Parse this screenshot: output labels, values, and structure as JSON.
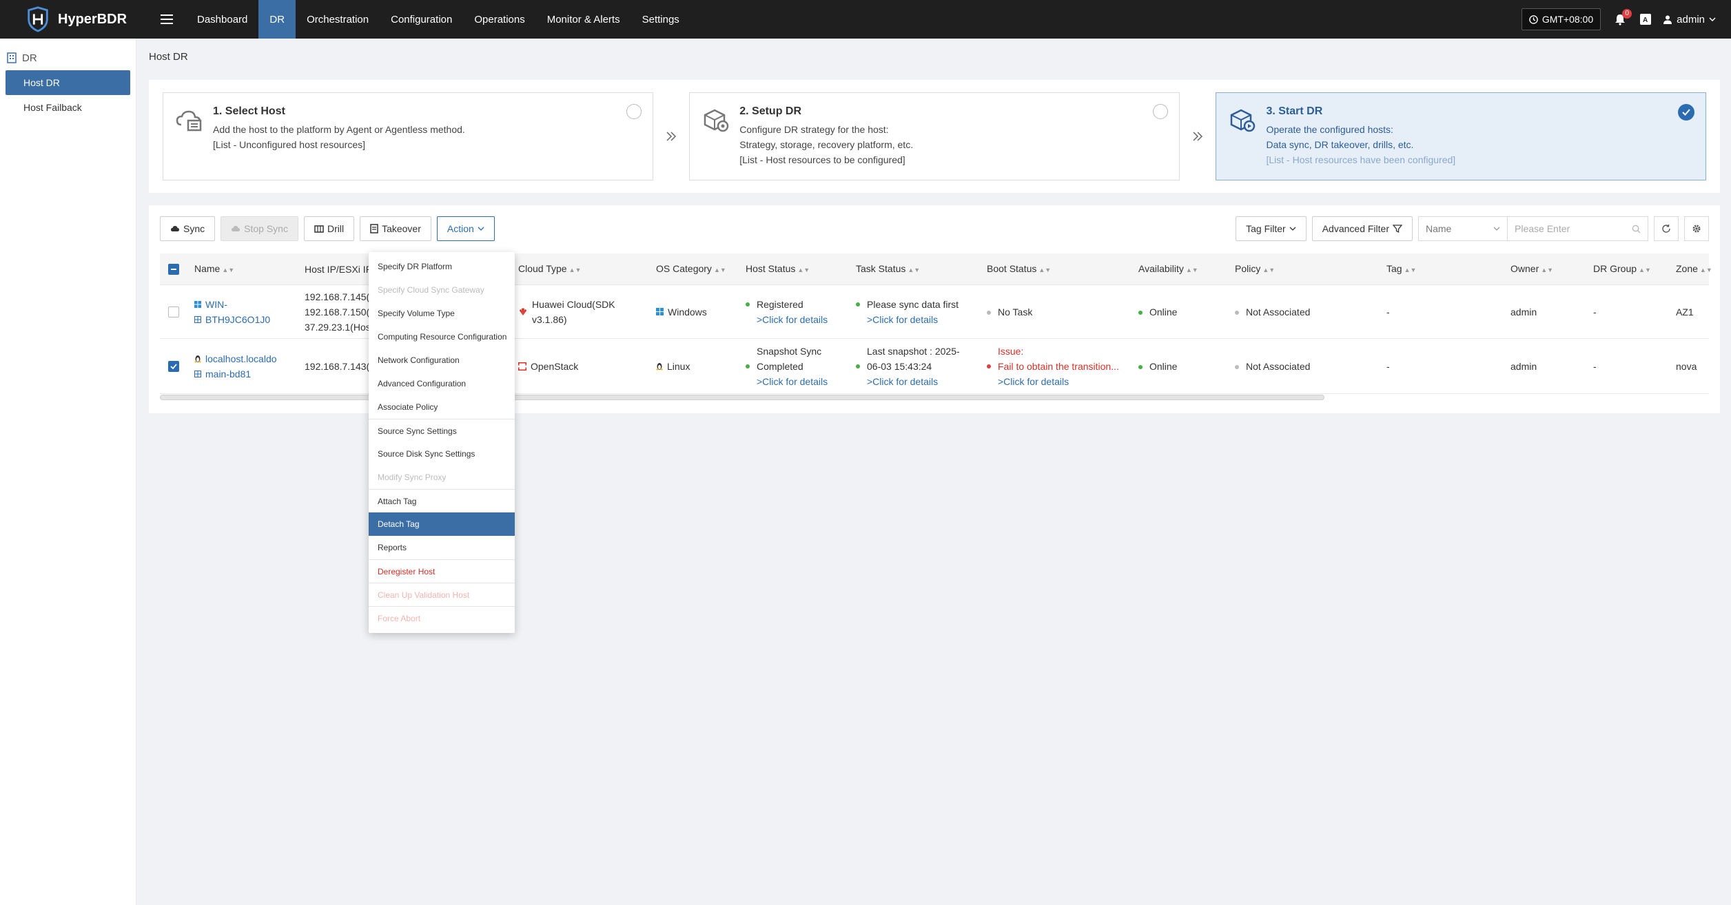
{
  "app": {
    "name": "HyperBDR"
  },
  "nav": {
    "items": [
      {
        "label": "Dashboard"
      },
      {
        "label": "DR"
      },
      {
        "label": "Orchestration"
      },
      {
        "label": "Configuration"
      },
      {
        "label": "Operations"
      },
      {
        "label": "Monitor & Alerts"
      },
      {
        "label": "Settings"
      }
    ],
    "active": "DR"
  },
  "topright": {
    "timezone": "GMT+08:00",
    "notification_count": "0",
    "user": "admin"
  },
  "sidebar": {
    "section": "DR",
    "items": [
      {
        "label": "Host DR"
      },
      {
        "label": "Host Failback"
      }
    ],
    "active": "Host DR"
  },
  "breadcrumb": "Host DR",
  "steps": [
    {
      "title": "1. Select Host",
      "lines": [
        "Add the host to the platform by Agent or Agentless method.",
        "[List - Unconfigured host resources]"
      ]
    },
    {
      "title": "2. Setup DR",
      "lines": [
        "Configure DR strategy for the host:",
        "Strategy, storage, recovery platform, etc.",
        "[List - Host resources to be configured]"
      ]
    },
    {
      "title": "3. Start DR",
      "lines": [
        "Operate the configured hosts:",
        "Data sync, DR takeover, drills, etc.",
        "[List - Host resources have been configured]"
      ]
    }
  ],
  "toolbar": {
    "sync": "Sync",
    "stop_sync": "Stop Sync",
    "drill": "Drill",
    "takeover": "Takeover",
    "action": "Action",
    "tag_filter": "Tag Filter",
    "advanced_filter": "Advanced Filter",
    "search_field": "Name",
    "search_placeholder": "Please Enter"
  },
  "table": {
    "columns": [
      "Name",
      "Host IP/ESXi IP",
      "Cloud Type",
      "OS Category",
      "Host Status",
      "Task Status",
      "Boot Status",
      "Availability",
      "Policy",
      "Tag",
      "Owner",
      "DR Group",
      "Zone"
    ],
    "rows": [
      {
        "name_line1": "WIN-",
        "name_line2": "BTH9JC6O1J0",
        "ip_lines": [
          "192.168.7.145(H",
          "192.168.7.150(H",
          "37.29.23.1(Host"
        ],
        "cloud_line1": "Huawei Cloud(SDK",
        "cloud_line2": "v3.1.86)",
        "os": "Windows",
        "host_status_line1": "Registered",
        "host_status_link": ">Click for details",
        "task_status_line1": "Please sync data first",
        "task_status_link": ">Click for details",
        "boot_status": "No Task",
        "availability": "Online",
        "policy": "Not Associated",
        "tag": "-",
        "owner": "admin",
        "dr_group": "-",
        "zone": "AZ1",
        "selected": false
      },
      {
        "name_line1": "localhost.localdo",
        "name_line2": "main-bd81",
        "ip_lines": [
          "192.168.7.143(H"
        ],
        "cloud_line1": "OpenStack",
        "os": "Linux",
        "host_status_line1": "Snapshot Sync",
        "host_status_line2": "Completed",
        "host_status_link": ">Click for details",
        "task_status_line1": "Last snapshot : 2025-",
        "task_status_line2": "06-03 15:43:24",
        "task_status_link": ">Click for details",
        "boot_status_line1": "Issue:",
        "boot_status_line2": "Fail to obtain the transition...",
        "boot_status_link": ">Click for details",
        "availability": "Online",
        "policy": "Not Associated",
        "tag": "-",
        "owner": "admin",
        "dr_group": "-",
        "zone": "nova",
        "selected": true
      }
    ]
  },
  "action_menu": {
    "items": [
      {
        "label": "Specify DR Platform",
        "state": "normal"
      },
      {
        "label": "Specify Cloud Sync Gateway",
        "state": "disabled"
      },
      {
        "label": "Specify Volume Type",
        "state": "normal"
      },
      {
        "label": "Computing Resource Configuration",
        "state": "normal"
      },
      {
        "label": "Network Configuration",
        "state": "normal"
      },
      {
        "label": "Advanced Configuration",
        "state": "normal"
      },
      {
        "label": "Associate Policy",
        "state": "normal"
      },
      {
        "label": "Source Sync Settings",
        "state": "normal"
      },
      {
        "label": "Source Disk Sync Settings",
        "state": "normal"
      },
      {
        "label": "Modify Sync Proxy",
        "state": "disabled"
      },
      {
        "label": "Attach Tag",
        "state": "normal"
      },
      {
        "label": "Detach Tag",
        "state": "active"
      },
      {
        "label": "Reports",
        "state": "normal"
      },
      {
        "label": "Deregister Host",
        "state": "danger"
      },
      {
        "label": "Clean Up Validation Host",
        "state": "danger-disabled"
      },
      {
        "label": "Force Abort",
        "state": "danger-disabled"
      }
    ]
  },
  "colors": {
    "accent": "#3b6ea5",
    "topbar": "#1f1f1f",
    "danger": "#d93026",
    "online": "#43b243"
  }
}
